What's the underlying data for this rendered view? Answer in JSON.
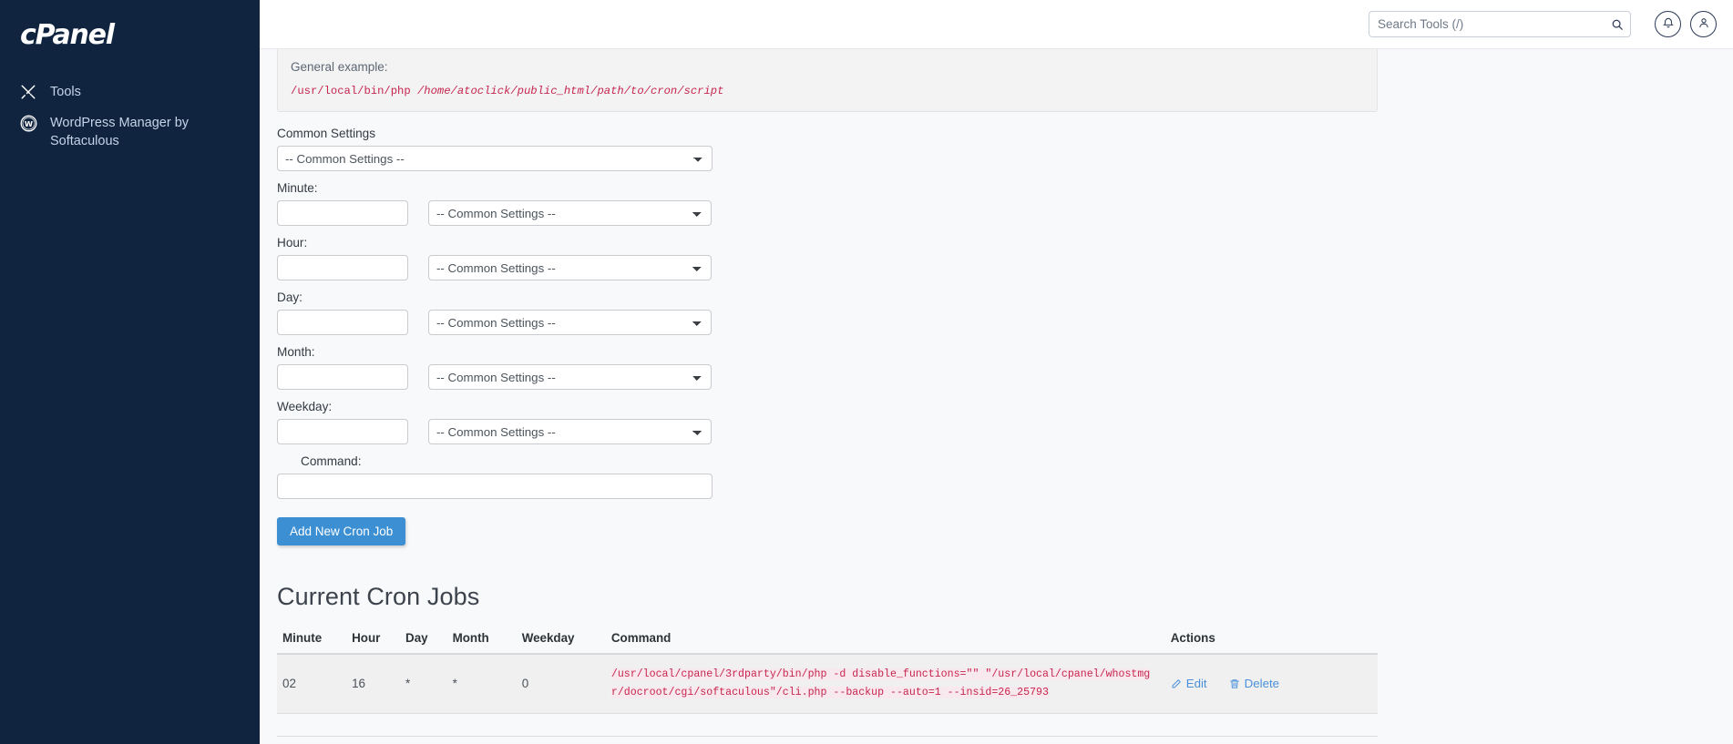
{
  "sidebar": {
    "brand": "cPanel",
    "items": [
      {
        "label": "Tools",
        "icon": "tools-icon"
      },
      {
        "label": "WordPress Manager by Softaculous",
        "icon": "wordpress-icon"
      }
    ]
  },
  "topbar": {
    "search_placeholder": "Search Tools (/)",
    "search_value": "",
    "search_icon": "search-icon",
    "notifications_icon": "bell-icon",
    "account_icon": "user-icon"
  },
  "example": {
    "label": "General example:",
    "code_plain": "/usr/local/bin/php ",
    "code_italic": "/home/atoclick/public_html/path/to/cron/script"
  },
  "form": {
    "common_settings_label": "Common Settings",
    "common_settings_value": "-- Common Settings --",
    "fields": [
      {
        "label": "Minute:",
        "value": "",
        "select_value": "-- Common Settings --"
      },
      {
        "label": "Hour:",
        "value": "",
        "select_value": "-- Common Settings --"
      },
      {
        "label": "Day:",
        "value": "",
        "select_value": "-- Common Settings --"
      },
      {
        "label": "Month:",
        "value": "",
        "select_value": "-- Common Settings --"
      },
      {
        "label": "Weekday:",
        "value": "",
        "select_value": "-- Common Settings --"
      }
    ],
    "command_label": "Command:",
    "command_value": "",
    "submit_label": "Add New Cron Job"
  },
  "current_jobs": {
    "title": "Current Cron Jobs",
    "columns": [
      "Minute",
      "Hour",
      "Day",
      "Month",
      "Weekday",
      "Command",
      "Actions"
    ],
    "rows": [
      {
        "minute": "02",
        "hour": "16",
        "day": "*",
        "month": "*",
        "weekday": "0",
        "command": "/usr/local/cpanel/3rdparty/bin/php -d disable_functions=\"\" \"/usr/local/cpanel/whostmgr/docroot/cgi/softaculous\"/cli.php --backup --auto=1 --insid=26_25793",
        "edit_label": "Edit",
        "delete_label": "Delete",
        "edit_icon": "pencil-icon",
        "delete_icon": "trash-icon"
      }
    ]
  },
  "colors": {
    "sidebar_bg": "#11243f",
    "accent_blue": "#3b8fd2",
    "link_blue": "#4a90d9",
    "code_red": "#c7254e",
    "page_bg": "#f8f9fa"
  }
}
